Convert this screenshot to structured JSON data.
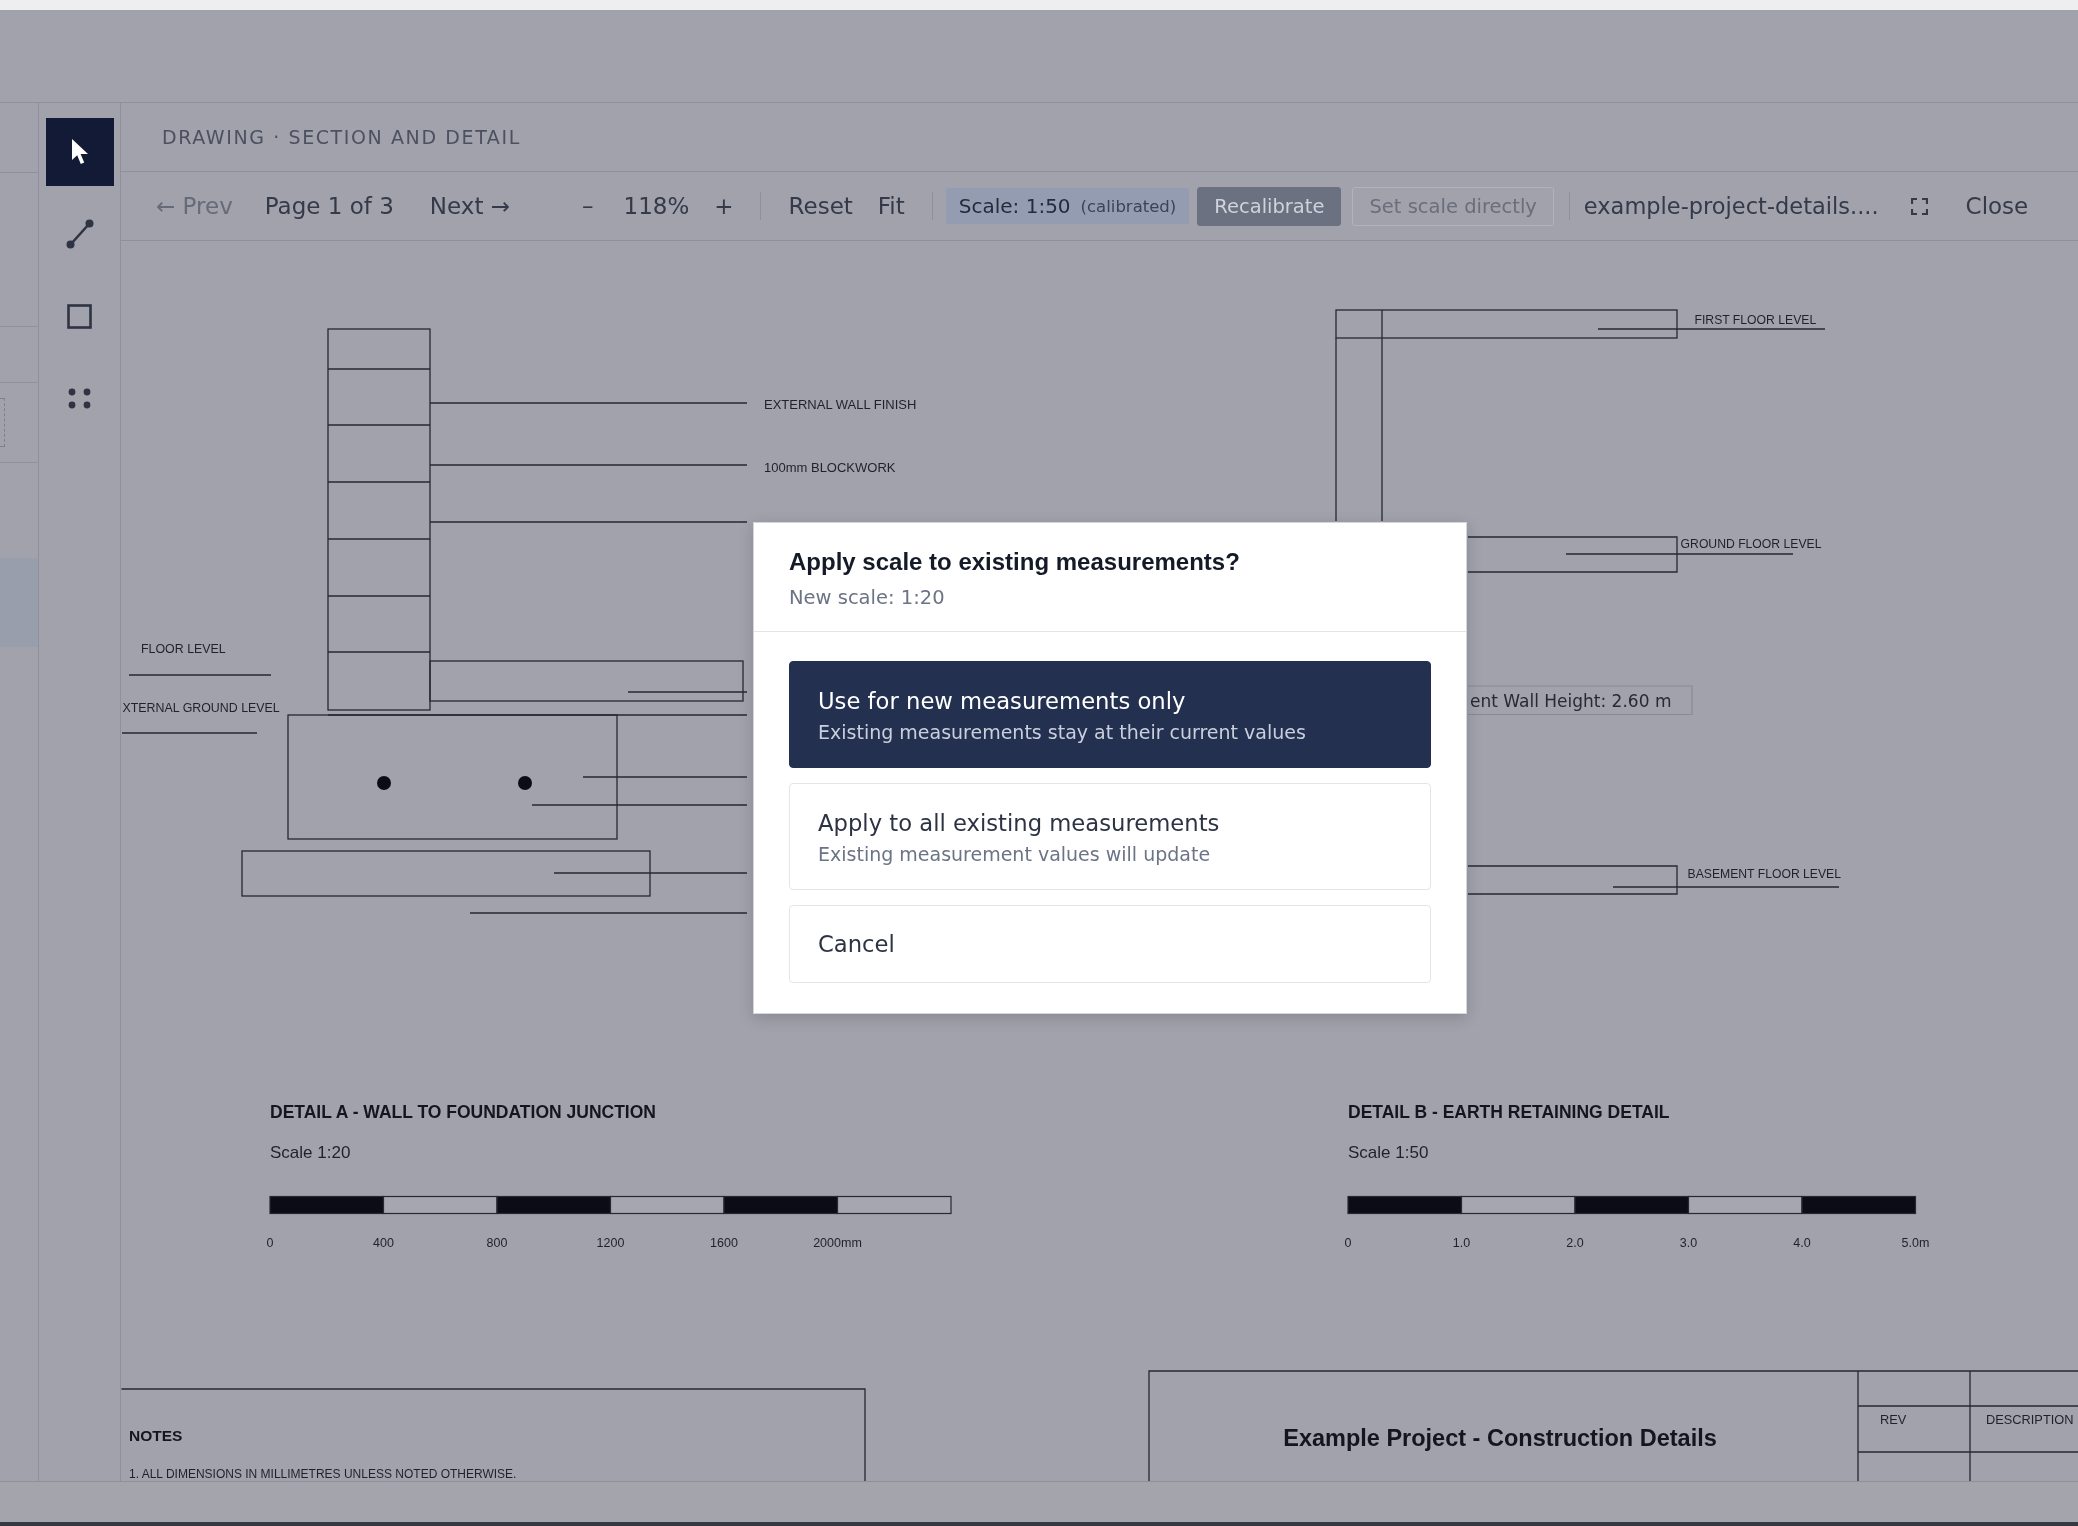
{
  "header": {
    "title": "DRAWING · SECTION AND DETAIL"
  },
  "tools": [
    {
      "kind": "select",
      "selected": true
    },
    {
      "kind": "line",
      "selected": false
    },
    {
      "kind": "rectangle",
      "selected": false
    },
    {
      "kind": "points",
      "selected": false
    }
  ],
  "toolbar": {
    "prev": {
      "label": "← Prev",
      "disabled": true
    },
    "page": "Page 1 of 3",
    "next": {
      "label": "Next →",
      "disabled": false
    },
    "zoom_out": "–",
    "zoom_level": "118%",
    "zoom_in": "+",
    "view_buttons": [
      "Reset",
      "Fit"
    ],
    "scale": {
      "value": "Scale: 1:50",
      "status": "(calibrated)"
    },
    "scale_buttons": [
      {
        "label": "Recalibrate",
        "kind": "filled",
        "disabled": false
      },
      {
        "label": "Set scale directly",
        "kind": "outline",
        "disabled": true
      }
    ],
    "file_name": "example-project-details....",
    "close": "Close"
  },
  "drawing": {
    "detail_a": {
      "callouts": [
        "EXTERNAL WALL FINISH",
        "100mm BLOCKWORK"
      ],
      "levels": [
        "FLOOR LEVEL",
        "XTERNAL GROUND LEVEL"
      ],
      "title": "DETAIL A - WALL TO FOUNDATION JUNCTION",
      "scale": "Scale 1:20",
      "scale_ticks": [
        "0",
        "400",
        "800",
        "1200",
        "1600",
        "2000mm"
      ]
    },
    "detail_b": {
      "levels": [
        "FIRST FLOOR LEVEL",
        "GROUND FLOOR LEVEL",
        "BASEMENT FLOOR LEVEL"
      ],
      "measurement": "ent Wall Height: 2.60 m",
      "title": "DETAIL B - EARTH RETAINING DETAIL",
      "scale": "Scale 1:50",
      "scale_ticks": [
        "0",
        "1.0",
        "2.0",
        "3.0",
        "4.0",
        "5.0m"
      ]
    },
    "notes": {
      "title": "NOTES",
      "items": [
        "1. ALL DIMENSIONS IN MILLIMETRES UNLESS NOTED OTHERWISE."
      ]
    },
    "title_block": {
      "project": "Example Project - Construction Details",
      "columns": [
        "REV",
        "DESCRIPTION"
      ]
    }
  },
  "dialog": {
    "title": "Apply scale to existing measurements?",
    "subtitle": "New scale: 1:20",
    "options": [
      {
        "title": "Use for new measurements only",
        "description": "Existing measurements stay at their current values",
        "selected": true
      },
      {
        "title": "Apply to all existing measurements",
        "description": "Existing measurement values will update",
        "selected": false
      }
    ],
    "cancel": "Cancel"
  }
}
